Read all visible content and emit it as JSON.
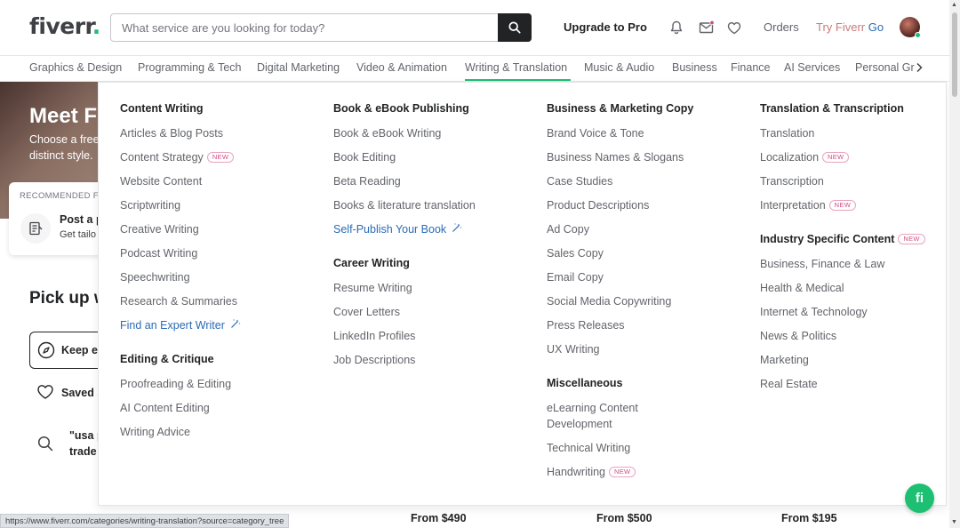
{
  "header": {
    "logo": "fiverr",
    "logo_dot": ".",
    "search_placeholder": "What service are you looking for today?",
    "upgrade": "Upgrade to Pro",
    "orders": "Orders",
    "try_go_a": "Try Fiverr",
    "try_go_b": " Go"
  },
  "categories": [
    "Graphics & Design",
    "Programming & Tech",
    "Digital Marketing",
    "Video & Animation",
    "Writing & Translation",
    "Music & Audio",
    "Business",
    "Finance",
    "AI Services",
    "Personal Gr"
  ],
  "active_category": "Writing & Translation",
  "background": {
    "hero_title": "Meet F",
    "hero_sub1": "Choose a free",
    "hero_sub2": "distinct style.",
    "rec_label": "RECOMMENDED F",
    "rec_title": "Post a p",
    "rec_desc": "Get tailo",
    "pickup": "Pick up w",
    "keep": "Keep e",
    "saved": "Saved s",
    "recent1": "\"usa p",
    "recent2": "trade",
    "prices": [
      "From $490",
      "From $500",
      "From $195"
    ],
    "status_url": "https://www.fiverr.com/categories/writing-translation?source=category_tree"
  },
  "menu": {
    "new_badge": "NEW",
    "col1": {
      "sec1_head": "Content Writing",
      "sec1_items": [
        "Articles & Blog Posts",
        "Content Strategy",
        "Website Content",
        "Scriptwriting",
        "Creative Writing",
        "Podcast Writing",
        "Speechwriting",
        "Research & Summaries"
      ],
      "sec1_link": "Find an Expert Writer",
      "sec2_head": "Editing & Critique",
      "sec2_items": [
        "Proofreading & Editing",
        "AI Content Editing",
        "Writing Advice"
      ]
    },
    "col2": {
      "sec1_head": "Book & eBook Publishing",
      "sec1_items": [
        "Book & eBook Writing",
        "Book Editing",
        "Beta Reading",
        "Books & literature translation"
      ],
      "sec1_link": "Self-Publish Your Book",
      "sec2_head": "Career Writing",
      "sec2_items": [
        "Resume Writing",
        "Cover Letters",
        "LinkedIn Profiles",
        "Job Descriptions"
      ]
    },
    "col3": {
      "sec1_head": "Business & Marketing Copy",
      "sec1_items": [
        "Brand Voice & Tone",
        "Business Names & Slogans",
        "Case Studies",
        "Product Descriptions",
        "Ad Copy",
        "Sales Copy",
        "Email Copy",
        "Social Media Copywriting",
        "Press Releases",
        "UX Writing"
      ],
      "sec2_head": "Miscellaneous",
      "sec2_items": [
        "eLearning Content",
        "Development",
        "Technical Writing",
        "Handwriting"
      ]
    },
    "col4": {
      "sec1_head": "Translation & Transcription",
      "sec1_items": [
        "Translation",
        "Localization",
        "Transcription",
        "Interpretation"
      ],
      "sec2_head": "Industry Specific Content",
      "sec2_items": [
        "Business, Finance & Law",
        "Health & Medical",
        "Internet & Technology",
        "News & Politics",
        "Marketing",
        "Real Estate"
      ]
    }
  },
  "chat_label": "fi",
  "colors": {
    "brand_green": "#1dbf73",
    "link_blue": "#2a6bb5",
    "new_badge": "#d04d80"
  }
}
